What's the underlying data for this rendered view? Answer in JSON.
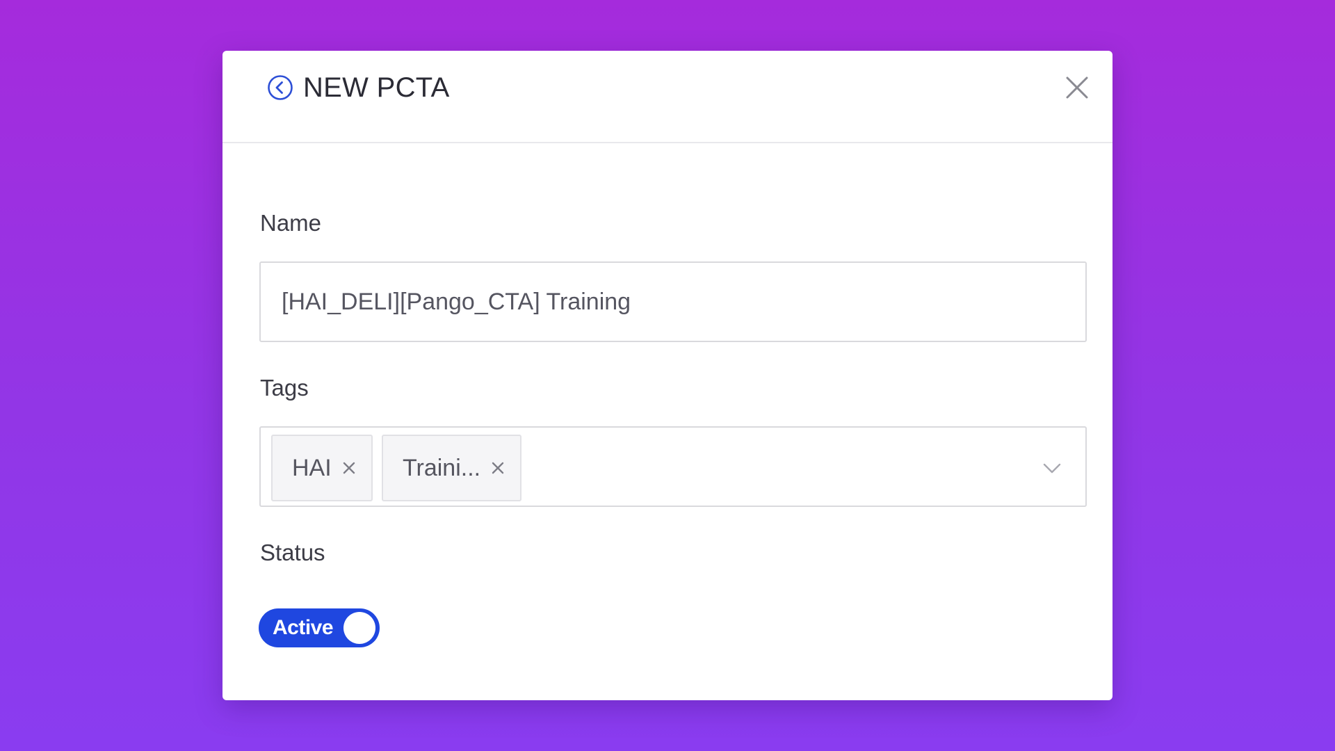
{
  "colors": {
    "background_gradient": [
      "#a52bdc",
      "#8a3cf0"
    ],
    "accent": "#1f47e0",
    "back_icon": "#2d4fd6"
  },
  "modal": {
    "title": "NEW PCTA",
    "back_icon": "circle-chevron-left-icon",
    "close_icon": "close-icon"
  },
  "form": {
    "name": {
      "label": "Name",
      "value": "[HAI_DELI][Pango_CTA] Training"
    },
    "tags": {
      "label": "Tags",
      "chips": [
        {
          "label": "HAI"
        },
        {
          "label": "Traini..."
        }
      ],
      "remove_icon": "x-icon",
      "dropdown_icon": "chevron-down-icon"
    },
    "status": {
      "label": "Status",
      "toggle_text": "Active",
      "on": true
    }
  }
}
